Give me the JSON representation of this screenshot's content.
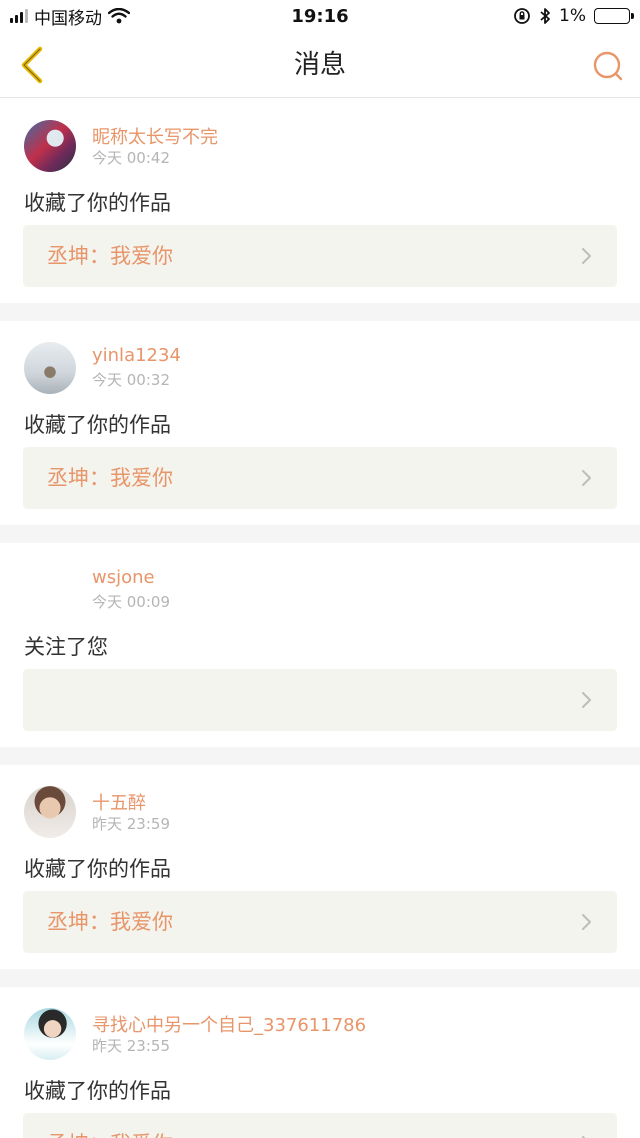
{
  "statusbar": {
    "carrier": "中国移动",
    "time": "19:16",
    "battery": "1%",
    "battery_level_fraction": 0.05
  },
  "nav": {
    "title": "消息",
    "back_icon": "chevron-left-icon",
    "search_icon": "search-icon"
  },
  "colors": {
    "accent": "#e8956a",
    "back": "#e6b800",
    "box_bg": "#f4f4ee"
  },
  "messages": [
    {
      "username": "昵称太长写不完",
      "time": "今天 00:42",
      "action": "收藏了你的作品",
      "work": "丞坤：我爱你"
    },
    {
      "username": "yinla1234",
      "time": "今天 00:32",
      "action": "收藏了你的作品",
      "work": "丞坤：我爱你"
    },
    {
      "username": "wsjone",
      "time": "今天 00:09",
      "action": "关注了您",
      "work": ""
    },
    {
      "username": "十五醉",
      "time": "昨天 23:59",
      "action": "收藏了你的作品",
      "work": "丞坤：我爱你"
    },
    {
      "username": "寻找心中另一个自己_337611786",
      "time": "昨天 23:55",
      "action": "收藏了你的作品",
      "work": "丞坤：我爱你"
    }
  ]
}
